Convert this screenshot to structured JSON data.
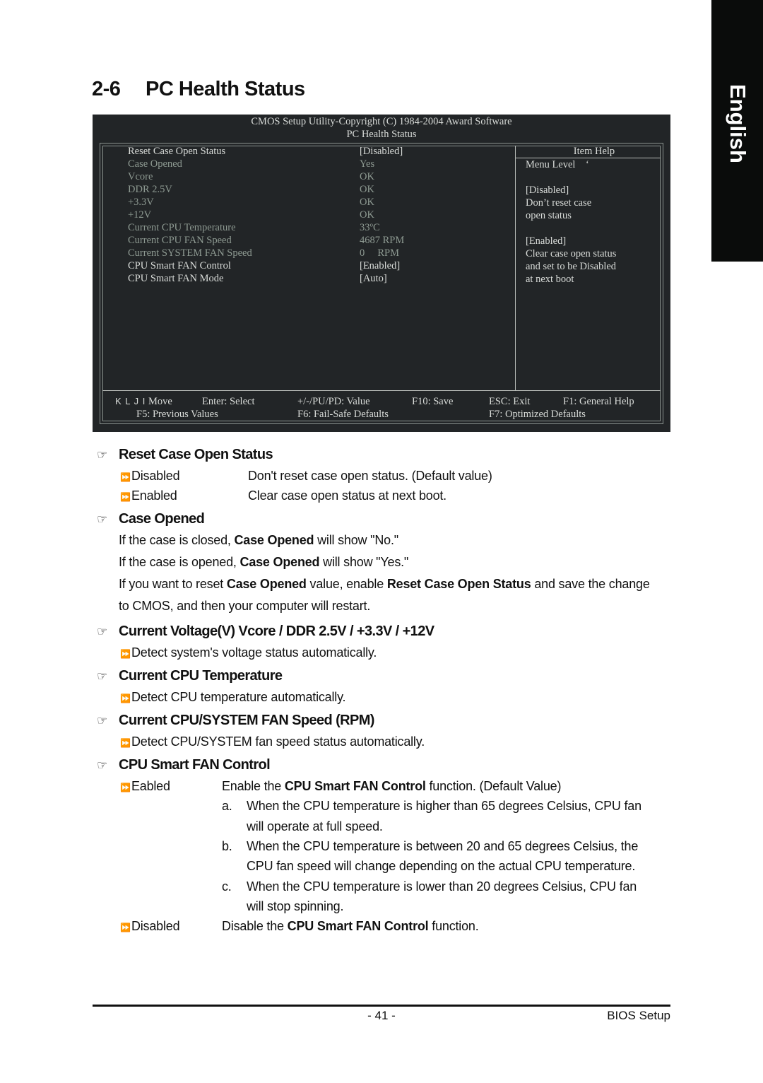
{
  "side_tab": {
    "label": "English"
  },
  "title": {
    "number": "2-6",
    "text": "PC Health Status"
  },
  "bios": {
    "header_line1": "CMOS Setup Utility-Copyright (C) 1984-2004 Award Software",
    "header_line2": "PC Health Status",
    "items": [
      {
        "label": "Reset Case Open Status",
        "value": "[Disabled]",
        "state": "selectable"
      },
      {
        "label": "Case Opened",
        "value": "Yes",
        "state": "readonly"
      },
      {
        "label": "Vcore",
        "value": "OK",
        "state": "readonly"
      },
      {
        "label": "DDR 2.5V",
        "value": "OK",
        "state": "readonly"
      },
      {
        "label": "+3.3V",
        "value": "OK",
        "state": "readonly"
      },
      {
        "label": "+12V",
        "value": "OK",
        "state": "readonly"
      },
      {
        "label": "Current CPU Temperature",
        "value": "33ºC",
        "state": "readonly"
      },
      {
        "label": "Current CPU FAN Speed",
        "value": "4687 RPM",
        "state": "readonly"
      },
      {
        "label": "Current SYSTEM FAN Speed",
        "value": "0     RPM",
        "state": "readonly"
      },
      {
        "label": "CPU Smart FAN Control",
        "value": "[Enabled]",
        "state": "selectable"
      },
      {
        "label": "CPU Smart FAN Mode",
        "value": "[Auto]",
        "state": "selectable"
      }
    ],
    "item_help": {
      "title": "Item Help",
      "text": "Menu Level    ‘\n\n[Disabled]\nDon’t reset case\nopen status\n\n[Enabled]\nClear case open status\nand set to be Disabled\nat next boot"
    },
    "keys": {
      "move_glyphs": "K L J I",
      "move": "Move",
      "enter": "Enter: Select",
      "value": "+/-/PU/PD: Value",
      "save": "F10: Save",
      "exit": "ESC: Exit",
      "help": "F1: General Help",
      "prev": "F5: Previous Values",
      "failsafe": "F6: Fail-Safe Defaults",
      "optimized": "F7: Optimized Defaults"
    }
  },
  "sections": {
    "reset": {
      "heading": "Reset Case Open Status",
      "options": [
        {
          "name": "Disabled",
          "desc": "Don't reset case open status. (Default value)"
        },
        {
          "name": "Enabled",
          "desc": "Clear case open status at next boot."
        }
      ]
    },
    "case_opened": {
      "heading": "Case Opened",
      "line1_a": "If the case is closed, ",
      "line1_b": "Case Opened",
      "line1_c": " will show \"No.\"",
      "line2_a": "If the case is opened, ",
      "line2_b": "Case Opened",
      "line2_c": " will show \"Yes.\"",
      "line3_a": "If you want to reset ",
      "line3_b": "Case Opened",
      "line3_c": " value, enable ",
      "line3_d": "Reset Case Open Status",
      "line3_e": " and save the change",
      "line4": "to CMOS, and then your computer will restart."
    },
    "voltage": {
      "heading": "Current Voltage(V) Vcore / DDR 2.5V / +3.3V / +12V",
      "desc": "Detect system's voltage status automatically."
    },
    "temperature": {
      "heading": "Current CPU Temperature",
      "desc": "Detect CPU temperature automatically."
    },
    "fan_speed": {
      "heading": "Current CPU/SYSTEM FAN Speed (RPM)",
      "desc": "Detect CPU/SYSTEM fan speed status automatically."
    },
    "smart_fan": {
      "heading": "CPU Smart FAN Control",
      "enabled_name": "Eabled",
      "enabled_a": "Enable the ",
      "enabled_b": "CPU Smart FAN Control",
      "enabled_c": " function. (Default Value)",
      "a_marker": "a.",
      "a_line1": "When the CPU temperature is higher than 65 degrees Celsius, CPU fan",
      "a_line2": "will operate at full speed.",
      "b_marker": "b.",
      "b_line1": "When the CPU temperature is between 20 and 65 degrees Celsius, the",
      "b_line2": "CPU fan speed will change depending on the actual CPU temperature.",
      "c_marker": "c.",
      "c_line1": "When the CPU temperature is lower than 20 degrees Celsius, CPU fan",
      "c_line2": "will stop spinning.",
      "disabled_name": "Disabled",
      "disabled_a": "Disable the ",
      "disabled_b": "CPU Smart FAN Control",
      "disabled_c": " function."
    }
  },
  "icons": {
    "section_marker": "☞",
    "option_marker": "⏩"
  },
  "footer": {
    "page": "- 41 -",
    "section": "BIOS Setup"
  }
}
